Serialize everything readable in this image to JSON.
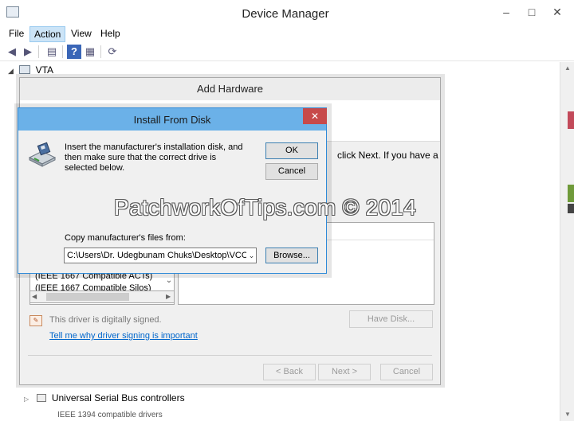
{
  "device_manager": {
    "title": "Device Manager",
    "menu": [
      "File",
      "Action",
      "View",
      "Help"
    ],
    "active_menu": "Action",
    "tree_root": "VTA",
    "tree_bottom_items": [
      "Universal Serial Bus controllers",
      "IEEE 1394 compatible drivers"
    ]
  },
  "add_hardware": {
    "title": "Add Hardware",
    "intro_fragment": "click Next. If you have a",
    "manufacturers": [
      "(IEEE 1667 Compatible ACTs)",
      "(IEEE 1667 Compatible Silos)"
    ],
    "signed_text": "This driver is digitally signed.",
    "signing_link": "Tell me why driver signing is important",
    "have_disk_label": "Have Disk...",
    "back_label": "< Back",
    "next_label": "Next >",
    "cancel_label": "Cancel"
  },
  "install_from_disk": {
    "title": "Install From Disk",
    "close_glyph": "✕",
    "message": "Insert the manufacturer's installation disk, and then make sure that the correct drive is selected below.",
    "ok_label": "OK",
    "cancel_label": "Cancel",
    "copy_label": "Copy manufacturer's files from:",
    "path_value": "C:\\Users\\Dr. Udegbunam Chuks\\Desktop\\VCOM\\",
    "browse_label": "Browse..."
  },
  "watermark": "PatchworkOfTips.com © 2014",
  "colors": {
    "ifd_titlebar": "#6bb1e8",
    "ifd_close": "#c74a4a",
    "link": "#0066cc",
    "menu_active": "#cce4f7"
  }
}
